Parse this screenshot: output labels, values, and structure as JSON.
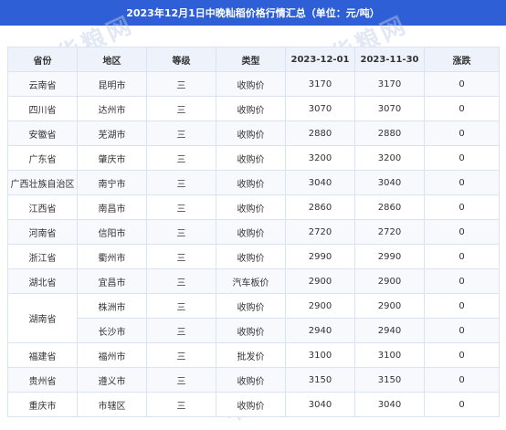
{
  "title": "2023年12月1日中晚籼稻价格行情汇总（单位：元/吨）",
  "headers": [
    "省份",
    "地区",
    "等级",
    "类型",
    "2023-12-01",
    "2023-11-30",
    "涨跌"
  ],
  "rows": [
    {
      "province": "云南省",
      "region": "昆明市",
      "grade": "三",
      "type": "收购价",
      "d1": "3170",
      "d2": "3170",
      "change": "0"
    },
    {
      "province": "四川省",
      "region": "达州市",
      "grade": "三",
      "type": "收购价",
      "d1": "3070",
      "d2": "3070",
      "change": "0"
    },
    {
      "province": "安徽省",
      "region": "芜湖市",
      "grade": "三",
      "type": "收购价",
      "d1": "2880",
      "d2": "2880",
      "change": "0"
    },
    {
      "province": "广东省",
      "region": "肇庆市",
      "grade": "三",
      "type": "收购价",
      "d1": "3200",
      "d2": "3200",
      "change": "0"
    },
    {
      "province": "广西壮族自治区",
      "region": "南宁市",
      "grade": "三",
      "type": "收购价",
      "d1": "3040",
      "d2": "3040",
      "change": "0"
    },
    {
      "province": "江西省",
      "region": "南昌市",
      "grade": "三",
      "type": "收购价",
      "d1": "2860",
      "d2": "2860",
      "change": "0"
    },
    {
      "province": "河南省",
      "region": "信阳市",
      "grade": "三",
      "type": "收购价",
      "d1": "2720",
      "d2": "2720",
      "change": "0"
    },
    {
      "province": "浙江省",
      "region": "衢州市",
      "grade": "三",
      "type": "收购价",
      "d1": "2990",
      "d2": "2990",
      "change": "0"
    },
    {
      "province": "湖北省",
      "region": "宜昌市",
      "grade": "三",
      "type": "汽车板价",
      "d1": "2900",
      "d2": "2900",
      "change": "0"
    },
    {
      "province": "湖南省",
      "region": "株洲市",
      "grade": "三",
      "type": "收购价",
      "d1": "2900",
      "d2": "2900",
      "change": "0"
    },
    {
      "province": "",
      "region": "长沙市",
      "grade": "三",
      "type": "收购价",
      "d1": "2940",
      "d2": "2940",
      "change": "0"
    },
    {
      "province": "福建省",
      "region": "福州市",
      "grade": "三",
      "type": "批发价",
      "d1": "3100",
      "d2": "3100",
      "change": "0"
    },
    {
      "province": "贵州省",
      "region": "遵义市",
      "grade": "三",
      "type": "收购价",
      "d1": "3150",
      "d2": "3150",
      "change": "0"
    },
    {
      "province": "重庆市",
      "region": "市辖区",
      "grade": "三",
      "type": "收购价",
      "d1": "3040",
      "d2": "3040",
      "change": "0"
    }
  ],
  "watermark_text": "中华粮网"
}
